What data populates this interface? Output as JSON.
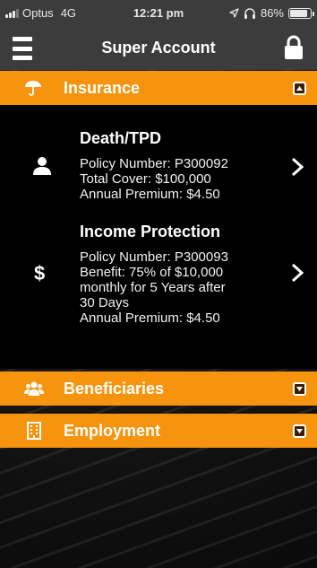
{
  "status_bar": {
    "carrier": "Optus",
    "network": "4G",
    "time": "12:21 pm",
    "battery_percent": "86%",
    "battery_level": 0.86
  },
  "header": {
    "title": "Super Account",
    "menu_icon": "hamburger-menu-icon",
    "lock_icon": "lock-icon"
  },
  "sections": {
    "insurance": {
      "label": "Insurance",
      "icon": "umbrella-icon",
      "expanded": true,
      "policies": [
        {
          "title": "Death/TPD",
          "icon": "person-icon",
          "lines": [
            "Policy Number: P300092",
            "Total Cover: $100,000",
            "Annual Premium: $4.50"
          ]
        },
        {
          "title": "Income Protection",
          "icon": "dollar-icon",
          "dollar_symbol": "$",
          "lines": [
            "Policy Number: P300093",
            "Benefit: 75% of $10,000",
            "monthly for 5 Years after",
            "30 Days",
            "Annual Premium: $4.50"
          ]
        }
      ]
    },
    "beneficiaries": {
      "label": "Beneficiaries",
      "icon": "users-icon",
      "expanded": false
    },
    "employment": {
      "label": "Employment",
      "icon": "building-icon",
      "expanded": false
    }
  },
  "colors": {
    "accent": "#f7940e",
    "header_bg": "#3c3c3c",
    "panel_bg": "#000000"
  }
}
